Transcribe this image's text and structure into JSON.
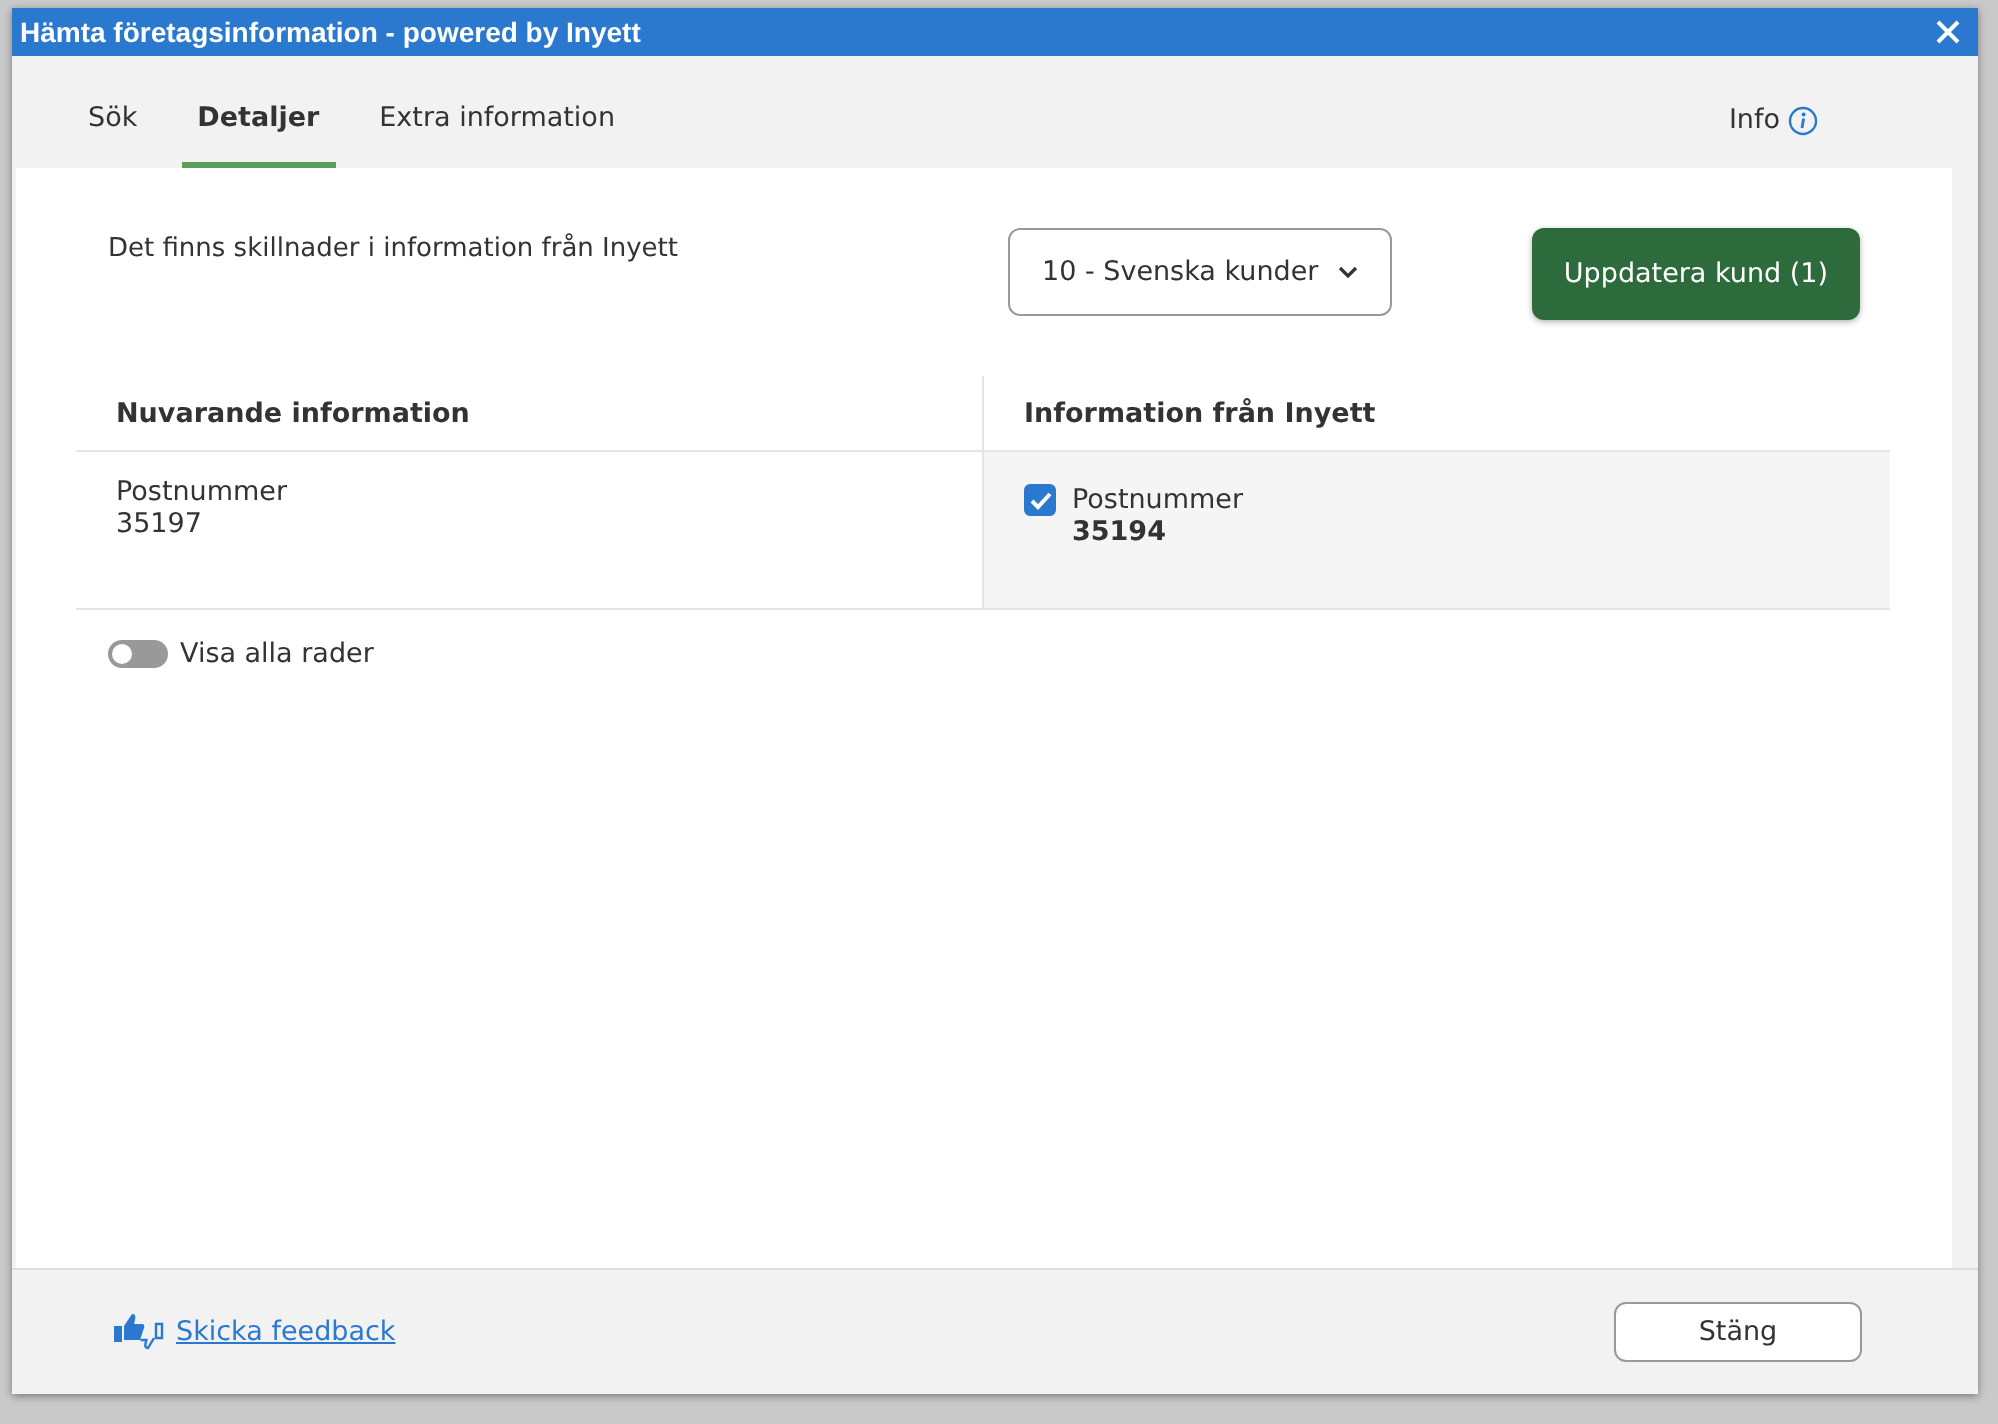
{
  "window": {
    "title": "Hämta företagsinformation - powered by Inyett"
  },
  "tabs": [
    {
      "label": "Sök",
      "selected": false
    },
    {
      "label": "Detaljer",
      "selected": true
    },
    {
      "label": "Extra information",
      "selected": false
    }
  ],
  "info_link": "Info",
  "message": "Det finns skillnader i information från Inyett",
  "customer_group_select": {
    "value": "10 - Svenska kunder"
  },
  "update_button": "Uppdatera kund (1)",
  "table": {
    "columns": [
      "Nuvarande information",
      "Information från Inyett"
    ],
    "rows": [
      {
        "current_label": "Postnummer",
        "current_value": "35197",
        "new_label": "Postnummer",
        "new_value": "35194",
        "checked": true
      }
    ]
  },
  "show_all_rows": {
    "label": "Visa alla rader",
    "on": false
  },
  "footer": {
    "feedback_link": "Skicka feedback",
    "close_button": "Stäng"
  }
}
